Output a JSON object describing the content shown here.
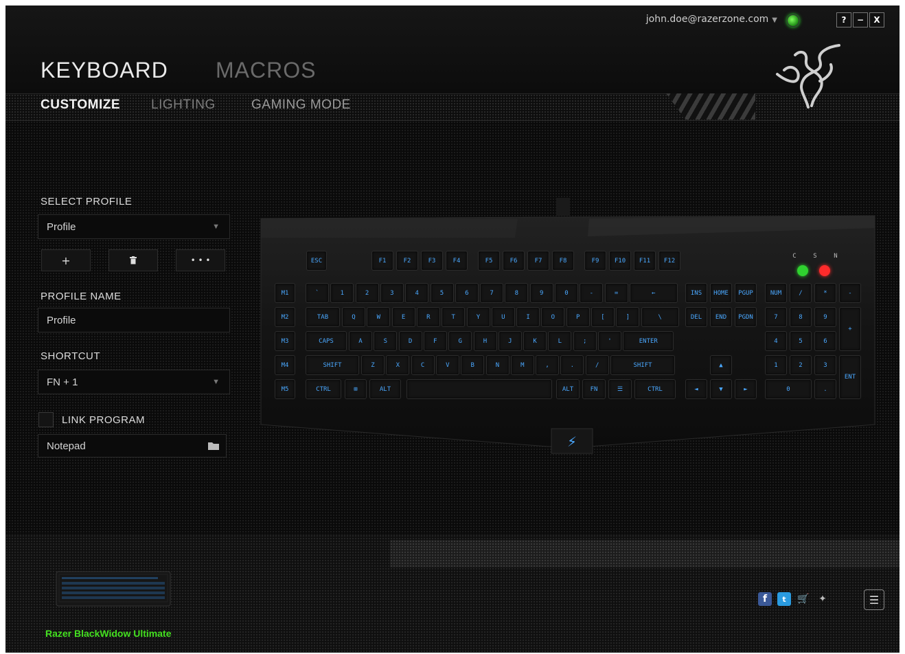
{
  "header": {
    "user_email": "john.doe@razerzone.com",
    "window_buttons": [
      "?",
      "−",
      "X"
    ],
    "main_tabs": [
      {
        "label": "KEYBOARD",
        "active": true
      },
      {
        "label": "MACROS",
        "active": false
      }
    ],
    "sub_tabs": [
      {
        "label": "CUSTOMIZE",
        "active": true
      },
      {
        "label": "LIGHTING",
        "active": false
      },
      {
        "label": "GAMING MODE",
        "active": false
      }
    ]
  },
  "profile_panel": {
    "select_profile_label": "SELECT PROFILE",
    "selected_profile": "Profile",
    "add_label": "+",
    "more_label": "• • •",
    "profile_name_label": "PROFILE NAME",
    "profile_name_value": "Profile",
    "shortcut_label": "SHORTCUT",
    "shortcut_value": "FN + 1",
    "link_program_label": "LINK PROGRAM",
    "link_program_checked": false,
    "program_value": "Notepad"
  },
  "keyboard": {
    "key_label_color": "#4aa8ff",
    "macro_keys": [
      "M1",
      "M2",
      "M3",
      "M4",
      "M5"
    ],
    "function_row": [
      "ESC",
      "F1",
      "F2",
      "F3",
      "F4",
      "F5",
      "F6",
      "F7",
      "F8",
      "F9",
      "F10",
      "F11",
      "F12"
    ],
    "number_row": [
      "`",
      "1",
      "2",
      "3",
      "4",
      "5",
      "6",
      "7",
      "8",
      "9",
      "0",
      "-",
      "=",
      "←"
    ],
    "top_row": [
      "TAB",
      "Q",
      "W",
      "E",
      "R",
      "T",
      "Y",
      "U",
      "I",
      "O",
      "P",
      "[",
      "]",
      "\\"
    ],
    "home_row": [
      "CAPS",
      "A",
      "S",
      "D",
      "F",
      "G",
      "H",
      "J",
      "K",
      "L",
      ";",
      "'",
      "ENTER"
    ],
    "bottom_row": [
      "SHIFT",
      "Z",
      "X",
      "C",
      "V",
      "B",
      "N",
      "M",
      ",",
      ".",
      "/",
      "SHIFT"
    ],
    "space_row": [
      "CTRL",
      "⊞",
      "ALT",
      "",
      "ALT",
      "FN",
      "☰",
      "CTRL"
    ],
    "numpad": [
      "NUM",
      "/",
      "*",
      "-",
      "7",
      "8",
      "9",
      "+",
      "4",
      "5",
      "6",
      "1",
      "2",
      "3",
      "ENT",
      "0",
      "."
    ],
    "nav_cluster": [
      "INS",
      "HOME",
      "PGUP",
      "DEL",
      "END",
      "PGDN",
      "▲",
      "◄",
      "▼",
      "►"
    ],
    "indicators": [
      "C",
      "S",
      "N"
    ]
  },
  "footer": {
    "device_name": "Razer BlackWidow Ultimate",
    "social": [
      "facebook-icon",
      "twitter-icon",
      "cart-icon",
      "razer-icon"
    ],
    "menu_icon": "☰",
    "accent_green": "#44e020"
  }
}
